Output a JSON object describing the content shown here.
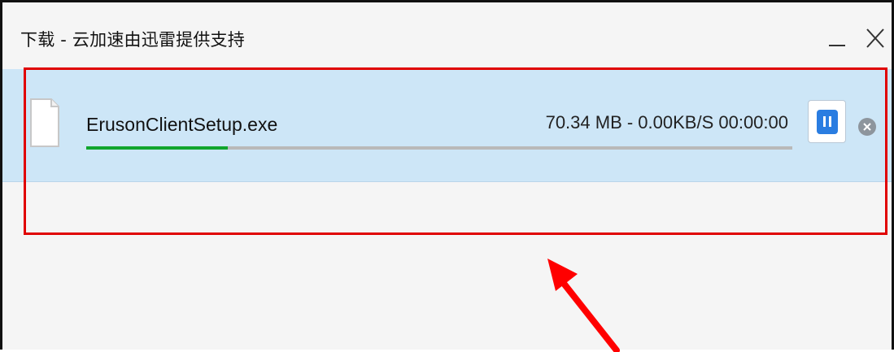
{
  "window": {
    "title": "下载 - 云加速由迅雷提供支持",
    "minimize_icon": "minimize-icon",
    "close_icon": "close-icon"
  },
  "download": {
    "file_name": "ErusonClientSetup.exe",
    "status_text": "70.34 MB - 0.00KB/S 00:00:00",
    "progress_fraction": 0.2,
    "file_icon": "document-icon",
    "pause_icon": "pause-icon",
    "remove_icon": "remove-icon"
  },
  "annotation": {
    "highlight_color": "#e00000",
    "arrow_color": "#ff0000"
  },
  "colors": {
    "row_background": "#cde6f7",
    "progress_green": "#11a52d",
    "pause_blue": "#2a7de1"
  }
}
